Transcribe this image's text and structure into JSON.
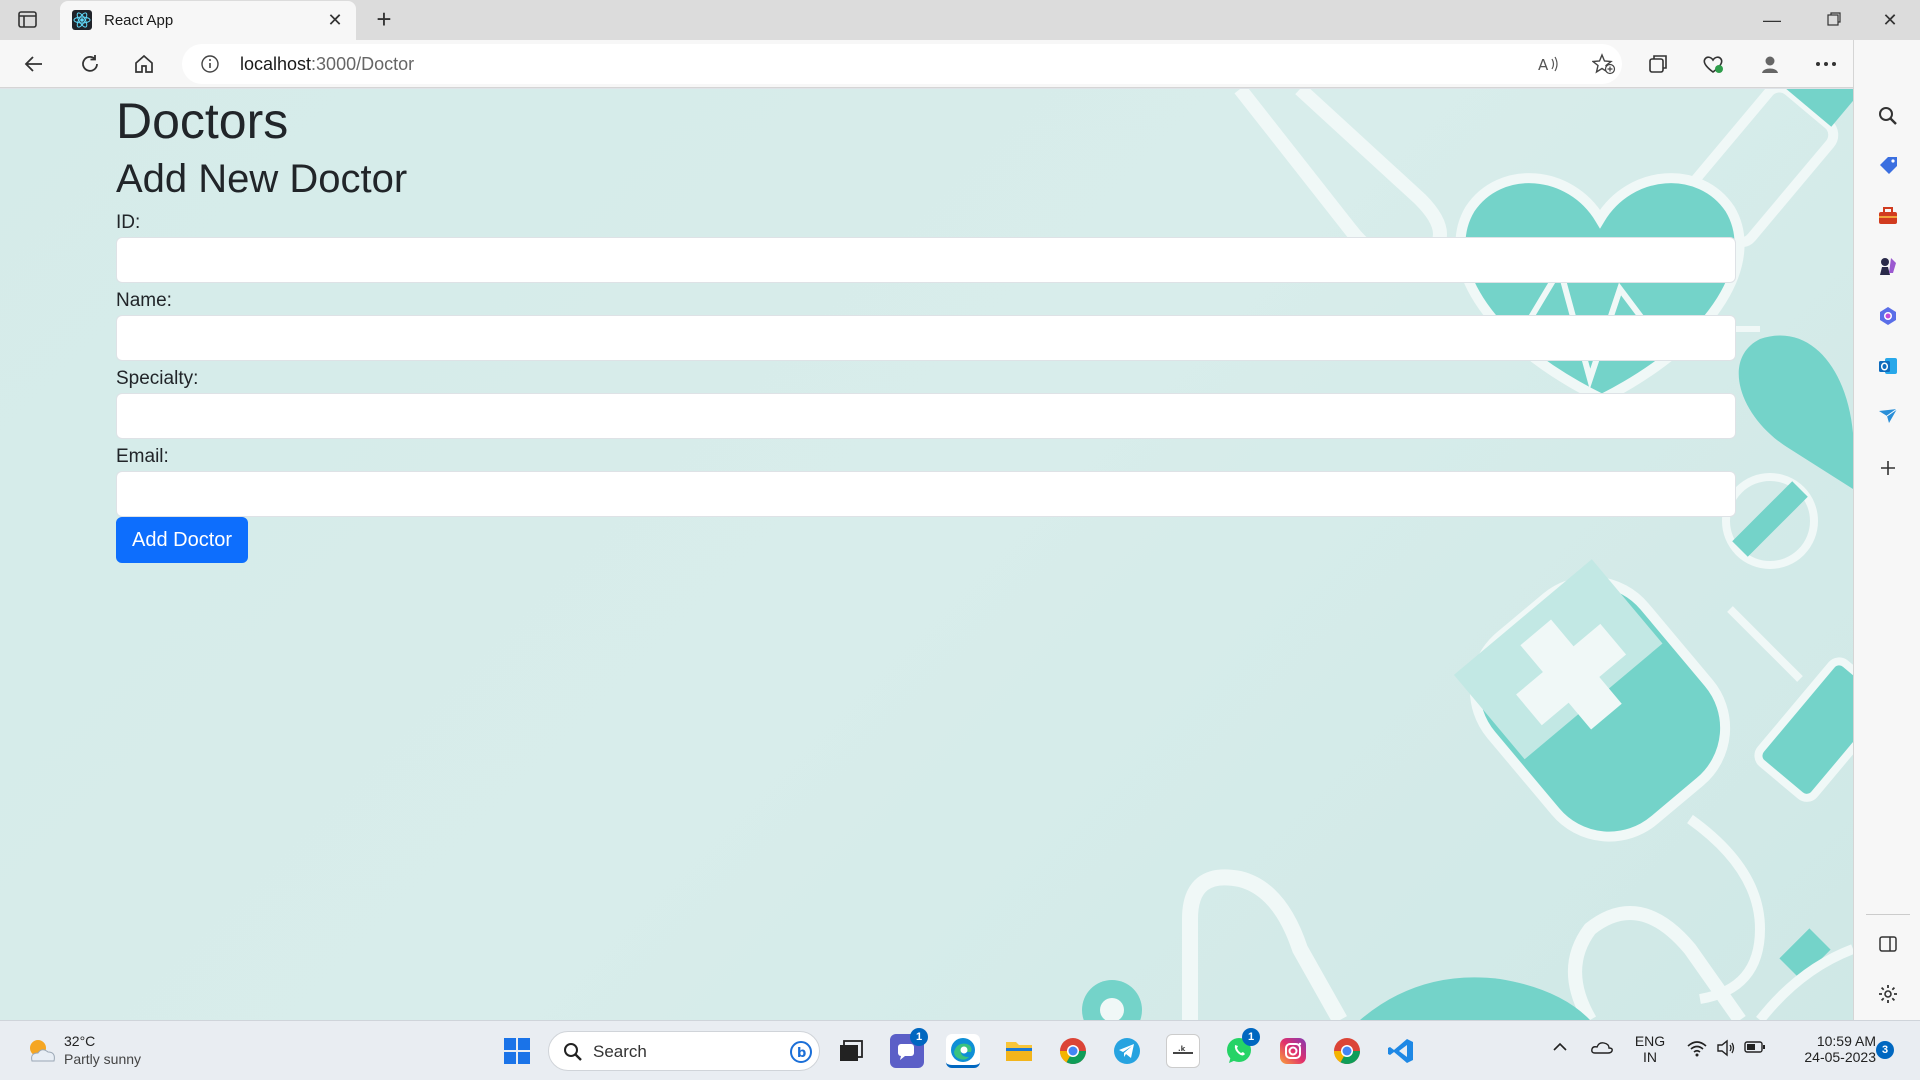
{
  "browser": {
    "tab_title": "React App",
    "url_host": "localhost",
    "url_path": ":3000/Doctor"
  },
  "page": {
    "heading": "Doctors",
    "subheading": "Add New Doctor",
    "fields": [
      {
        "label": "ID:",
        "value": ""
      },
      {
        "label": "Name:",
        "value": ""
      },
      {
        "label": "Specialty:",
        "value": ""
      },
      {
        "label": "Email:",
        "value": ""
      }
    ],
    "submit_label": "Add Doctor"
  },
  "taskbar": {
    "weather_temp": "32°C",
    "weather_condition": "Partly sunny",
    "search_placeholder": "Search",
    "teams_badge": "1",
    "whatsapp_badge": "1",
    "language": "ENG",
    "region": "IN",
    "time": "10:59 AM",
    "date": "24-05-2023",
    "notification_count": "3"
  },
  "colors": {
    "accent": "#0d6efd",
    "page_bg": "#d5ebe9",
    "deco_teal": "#74d3c9"
  }
}
